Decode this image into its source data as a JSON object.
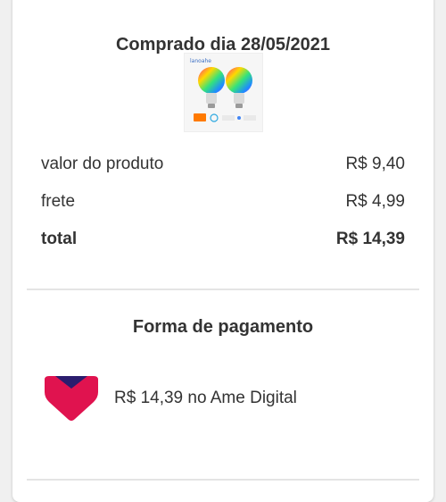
{
  "purchase": {
    "title": "Comprado dia 28/05/2021",
    "product_image": "smart-rgb-bulbs-pair"
  },
  "summary": {
    "rows": [
      {
        "label": "valor do produto",
        "value": "R$ 9,40"
      },
      {
        "label": "frete",
        "value": "R$ 4,99"
      },
      {
        "label": "total",
        "value": "R$ 14,39"
      }
    ]
  },
  "payment": {
    "title": "Forma de pagamento",
    "method_text": "R$ 14,39 no Ame Digital",
    "logo": "ame-digital-logo"
  },
  "colors": {
    "ame_pink": "#e0134f",
    "ame_navy": "#2b1d6e",
    "divider": "#e4e4e4",
    "text": "#333333"
  }
}
